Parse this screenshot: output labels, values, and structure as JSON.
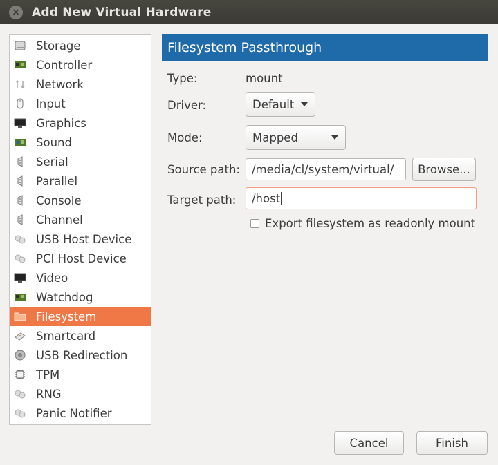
{
  "window": {
    "title": "Add New Virtual Hardware"
  },
  "sidebar": {
    "items": [
      {
        "label": "Storage",
        "icon": "storage-icon"
      },
      {
        "label": "Controller",
        "icon": "controller-icon"
      },
      {
        "label": "Network",
        "icon": "network-icon"
      },
      {
        "label": "Input",
        "icon": "mouse-icon"
      },
      {
        "label": "Graphics",
        "icon": "monitor-icon"
      },
      {
        "label": "Sound",
        "icon": "sound-card-icon"
      },
      {
        "label": "Serial",
        "icon": "serial-port-icon"
      },
      {
        "label": "Parallel",
        "icon": "parallel-port-icon"
      },
      {
        "label": "Console",
        "icon": "console-port-icon"
      },
      {
        "label": "Channel",
        "icon": "channel-port-icon"
      },
      {
        "label": "USB Host Device",
        "icon": "usb-device-icon"
      },
      {
        "label": "PCI Host Device",
        "icon": "pci-device-icon"
      },
      {
        "label": "Video",
        "icon": "video-monitor-icon"
      },
      {
        "label": "Watchdog",
        "icon": "watchdog-card-icon"
      },
      {
        "label": "Filesystem",
        "icon": "folder-icon"
      },
      {
        "label": "Smartcard",
        "icon": "smartcard-icon"
      },
      {
        "label": "USB Redirection",
        "icon": "usb-redirection-icon"
      },
      {
        "label": "TPM",
        "icon": "chip-icon"
      },
      {
        "label": "RNG",
        "icon": "rng-icon"
      },
      {
        "label": "Panic Notifier",
        "icon": "panic-notifier-icon"
      }
    ],
    "selected_index": 14
  },
  "panel": {
    "header": "Filesystem Passthrough",
    "type_label": "Type:",
    "type_value": "mount",
    "driver_label": "Driver:",
    "driver_value": "Default",
    "mode_label": "Mode:",
    "mode_value": "Mapped",
    "source_label": "Source path:",
    "source_value": "/media/cl/system/virtual/",
    "browse_label": "Browse...",
    "target_label": "Target path:",
    "target_value": "/host",
    "readonly_label": "Export filesystem as readonly mount",
    "readonly_checked": false
  },
  "footer": {
    "cancel_label": "Cancel",
    "finish_label": "Finish"
  },
  "colors": {
    "selection": "#f07746",
    "header": "#1f6aa8",
    "titlebar": "#3b3a35"
  }
}
